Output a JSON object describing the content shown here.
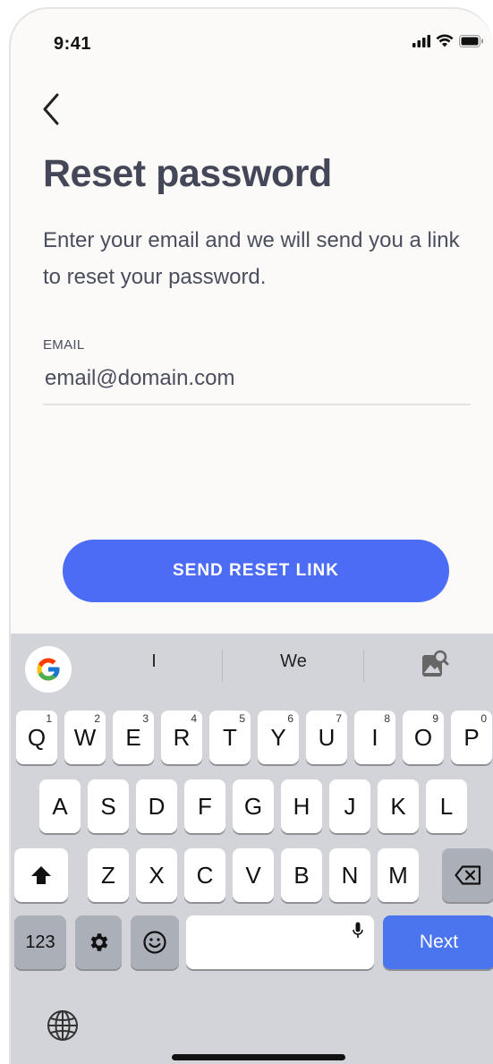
{
  "status_bar": {
    "time": "9:41",
    "signal_icon": "cellular-signal-icon",
    "wifi_icon": "wifi-icon",
    "battery_icon": "battery-icon"
  },
  "nav": {
    "back_icon": "chevron-left-icon"
  },
  "screen": {
    "title": "Reset password",
    "description": "Enter your email and we will send you a link to reset your password.",
    "email_label": "EMAIL",
    "email_placeholder": "email@domain.com",
    "email_value": "",
    "submit_label": "SEND RESET LINK"
  },
  "keyboard": {
    "suggestions": [
      "I",
      "We"
    ],
    "google_icon": "google-g-icon",
    "lens_icon": "image-search-icon",
    "row1": [
      {
        "key": "Q",
        "hint": "1"
      },
      {
        "key": "W",
        "hint": "2"
      },
      {
        "key": "E",
        "hint": "3"
      },
      {
        "key": "R",
        "hint": "4"
      },
      {
        "key": "T",
        "hint": "5"
      },
      {
        "key": "Y",
        "hint": "6"
      },
      {
        "key": "U",
        "hint": "7"
      },
      {
        "key": "I",
        "hint": "8"
      },
      {
        "key": "O",
        "hint": "9"
      },
      {
        "key": "P",
        "hint": "0"
      }
    ],
    "row2": [
      "A",
      "S",
      "D",
      "F",
      "G",
      "H",
      "J",
      "K",
      "L"
    ],
    "row3": [
      "Z",
      "X",
      "C",
      "V",
      "B",
      "N",
      "M"
    ],
    "numbers_label": "123",
    "next_label": "Next",
    "shift_icon": "shift-icon",
    "backspace_icon": "backspace-icon",
    "settings_icon": "gear-icon",
    "emoji_icon": "emoji-icon",
    "mic_icon": "microphone-icon",
    "globe_icon": "globe-icon"
  },
  "colors": {
    "accent": "#4d6cf6",
    "title": "#434758",
    "keyboard_bg": "#d2d4d9",
    "next_key": "#4b75ee"
  }
}
